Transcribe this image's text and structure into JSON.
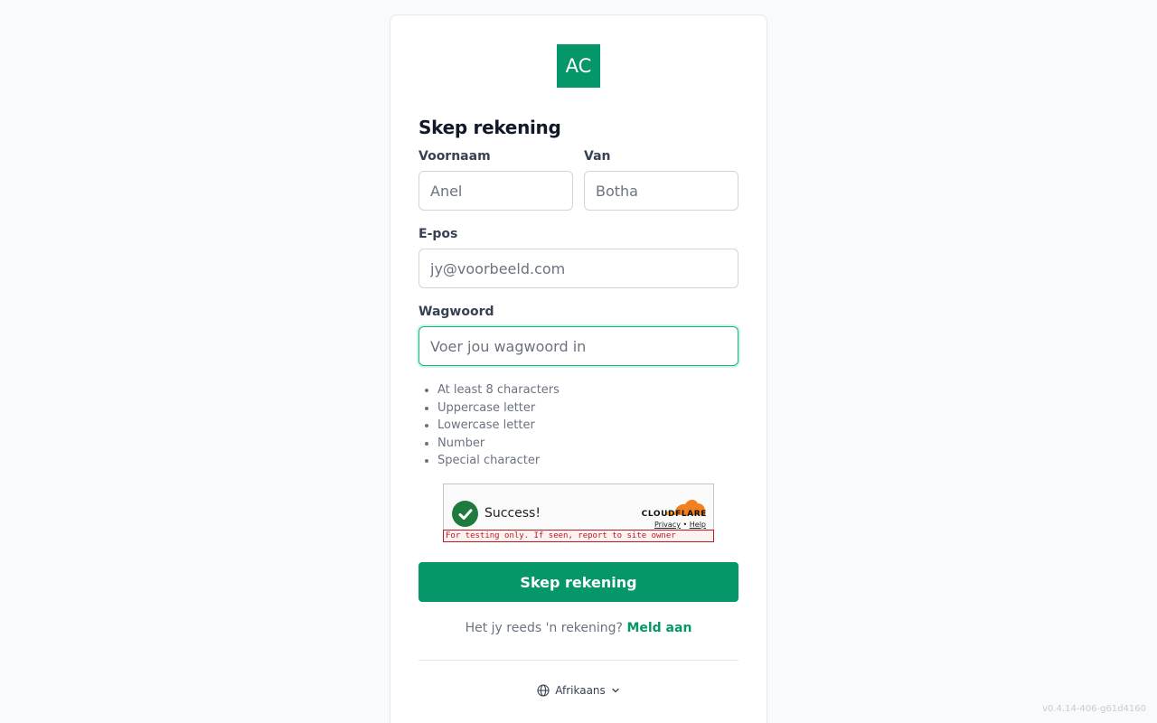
{
  "brand": {
    "logo_text": "AC",
    "color": "#059669"
  },
  "form": {
    "title": "Skep rekening",
    "first_name": {
      "label": "Voornaam",
      "placeholder": "Anel"
    },
    "last_name": {
      "label": "Van",
      "placeholder": "Botha"
    },
    "email": {
      "label": "E-pos",
      "placeholder": "jy@voorbeeld.com"
    },
    "password": {
      "label": "Wagwoord",
      "placeholder": "Voer jou wagwoord in"
    },
    "requirements": [
      "At least 8 characters",
      "Uppercase letter",
      "Lowercase letter",
      "Number",
      "Special character"
    ],
    "submit_label": "Skep rekening"
  },
  "captcha": {
    "status": "Success!",
    "provider": "CLOUDFLARE",
    "privacy": "Privacy",
    "separator": "•",
    "help": "Help",
    "warning": "For testing only. If seen, report to site owner"
  },
  "signin": {
    "prompt": "Het jy reeds 'n rekening?",
    "link": "Meld aan"
  },
  "language": {
    "current": "Afrikaans",
    "icon": "globe-icon"
  },
  "version": "v0.4.14-406-g61d4160"
}
